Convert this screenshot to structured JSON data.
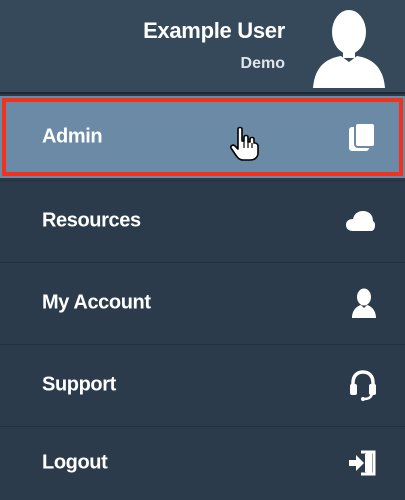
{
  "user": {
    "name": "Example User",
    "role": "Demo",
    "avatar_icon": "user-silhouette-icon"
  },
  "menu": {
    "items": [
      {
        "label": "Admin",
        "icon": "documents-icon",
        "active": true
      },
      {
        "label": "Resources",
        "icon": "cloud-icon"
      },
      {
        "label": "My Account",
        "icon": "person-icon"
      },
      {
        "label": "Support",
        "icon": "headset-icon"
      },
      {
        "label": "Logout",
        "icon": "sign-out-icon"
      }
    ]
  },
  "colors": {
    "menu_bg": "#2b3b4c",
    "header_bg": "#35495a",
    "active_bg": "#6b8aa6",
    "highlight_border": "#f0321f"
  }
}
